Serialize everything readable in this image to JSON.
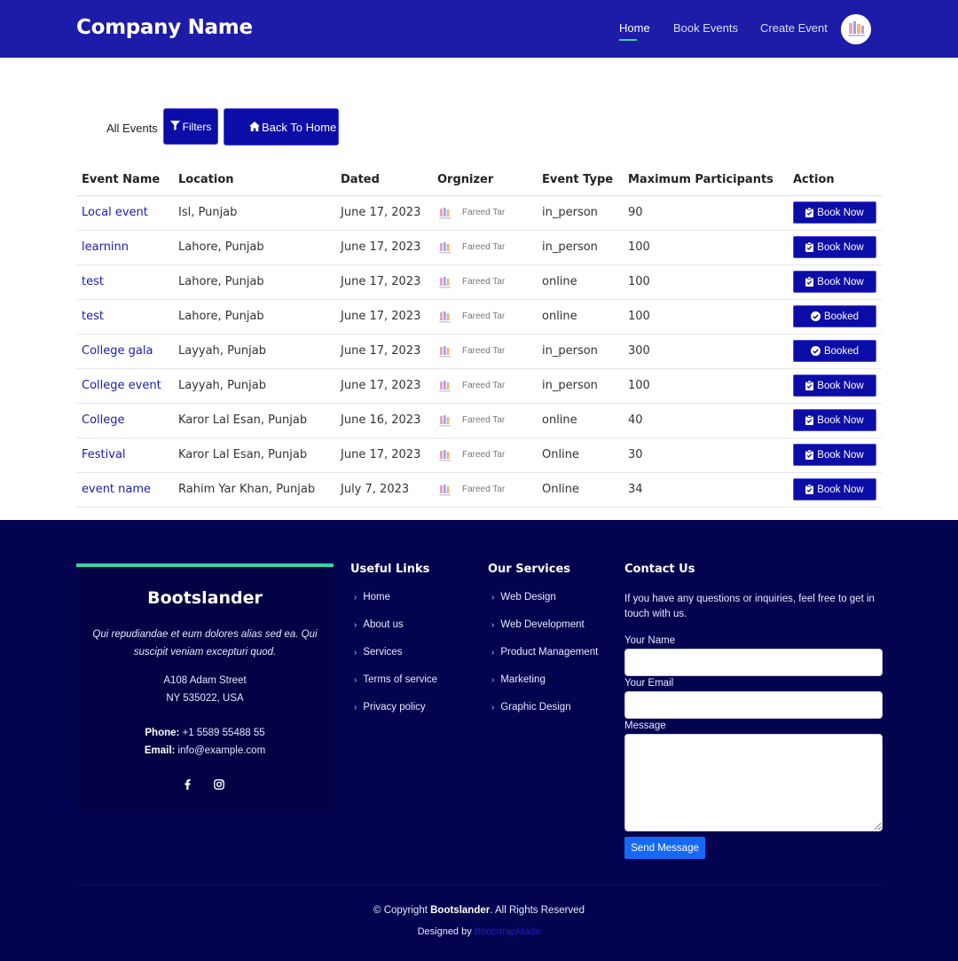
{
  "header": {
    "logo": "Company Name",
    "nav": [
      "Home",
      "Book Events",
      "Create Event"
    ],
    "active_nav": "Home"
  },
  "toolbar": {
    "all_events": "All Events",
    "filters": "Filters",
    "back_home": "Back To Home"
  },
  "table": {
    "columns": [
      "Event Name",
      "Location",
      "Dated",
      "Orgnizer",
      "Event Type",
      "Maximum Participants",
      "Action"
    ],
    "rows": [
      {
        "name": "Local event",
        "location": "Isl, Punjab",
        "date": "June 17, 2023",
        "organizer": "Fareed Tar",
        "type": "in_person",
        "max": "90",
        "action": "Book Now"
      },
      {
        "name": "learninn",
        "location": "Lahore, Punjab",
        "date": "June 17, 2023",
        "organizer": "Fareed Tar",
        "type": "in_person",
        "max": "100",
        "action": "Book Now"
      },
      {
        "name": "test",
        "location": "Lahore, Punjab",
        "date": "June 17, 2023",
        "organizer": "Fareed Tar",
        "type": "online",
        "max": "100",
        "action": "Book Now"
      },
      {
        "name": "test",
        "location": "Lahore, Punjab",
        "date": "June 17, 2023",
        "organizer": "Fareed Tar",
        "type": "online",
        "max": "100",
        "action": "Booked"
      },
      {
        "name": "College gala",
        "location": "Layyah, Punjab",
        "date": "June 17, 2023",
        "organizer": "Fareed Tar",
        "type": "in_person",
        "max": "300",
        "action": "Booked"
      },
      {
        "name": "College event",
        "location": "Layyah, Punjab",
        "date": "June 17, 2023",
        "organizer": "Fareed Tar",
        "type": "in_person",
        "max": "100",
        "action": "Book Now"
      },
      {
        "name": "College",
        "location": "Karor Lal Esan, Punjab",
        "date": "June 16, 2023",
        "organizer": "Fareed Tar",
        "type": "online",
        "max": "40",
        "action": "Book Now"
      },
      {
        "name": "Festival",
        "location": "Karor Lal Esan, Punjab",
        "date": "June 17, 2023",
        "organizer": "Fareed Tar",
        "type": "Online",
        "max": "30",
        "action": "Book Now"
      },
      {
        "name": "event name",
        "location": "Rahim Yar Khan, Punjab",
        "date": "July 7, 2023",
        "organizer": "Fareed Tar",
        "type": "Online",
        "max": "34",
        "action": "Book Now"
      }
    ]
  },
  "footer": {
    "brand": "Bootslander",
    "quote": "Qui repudiandae et eum dolores alias sed ea. Qui suscipit veniam excepturi quod.",
    "address_line1": "A108 Adam Street",
    "address_line2": "NY 535022, USA",
    "phone_label": "Phone:",
    "phone": "+1 5589 55488 55",
    "email_label": "Email:",
    "email": "info@example.com",
    "useful_links_title": "Useful Links",
    "useful_links": [
      "Home",
      "About us",
      "Services",
      "Terms of service",
      "Privacy policy"
    ],
    "services_title": "Our Services",
    "services": [
      "Web Design",
      "Web Development",
      "Product Management",
      "Marketing",
      "Graphic Design"
    ],
    "contact_title": "Contact Us",
    "contact_text": "If you have any questions or inquiries, feel free to get in touch with us.",
    "name_label": "Your Name",
    "email_field_label": "Your Email",
    "message_label": "Message",
    "send": "Send Message",
    "copyright_prefix": "© Copyright ",
    "copyright_brand": "Bootslander",
    "copyright_suffix": ". All Rights Reserved",
    "designed_by": "Designed by ",
    "designer": "BootstrapMade"
  },
  "colors": {
    "header_bg": "#1c1ca8",
    "button_bg": "#0c0ca6",
    "footer_bg": "#03034f",
    "accent": "#3bd3a8",
    "send_button": "#1569f5"
  },
  "icons": {
    "filters": "filter-icon",
    "back_home": "home-icon",
    "book_now": "clipboard-check-icon",
    "booked": "check-circle-icon",
    "links": "chevron-right-icon",
    "social": [
      "facebook-icon",
      "instagram-icon"
    ]
  }
}
